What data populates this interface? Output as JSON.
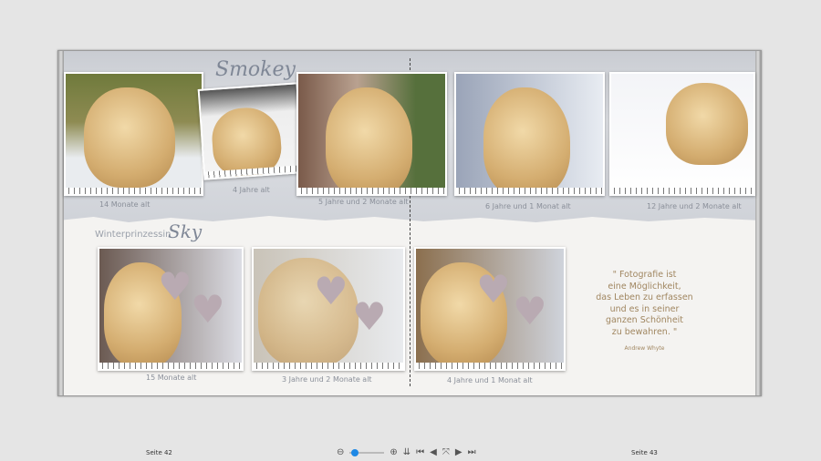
{
  "left_page": {
    "title_top": "Smokey",
    "title_bottom_prefix": "Winterprinzessin",
    "title_bottom_name": "Sky",
    "captions": [
      "14 Monate alt",
      "4 Jahre alt",
      "5 Jahre und 2 Monate alt",
      "15 Monate alt",
      "3 Jahre und 2 Monate alt"
    ],
    "page_label": "Seite 42"
  },
  "right_page": {
    "captions": [
      "6 Jahre und 1 Monat alt",
      "12 Jahre und 2 Monate alt",
      "4 Jahre und 1 Monat alt"
    ],
    "quote": [
      "\" Fotografie ist",
      "eine Möglichkeit,",
      "das Leben zu erfassen",
      "und es in seiner",
      "ganzen Schönheit",
      "zu bewahren. \""
    ],
    "quote_author": "Andrew Whyte",
    "page_label": "Seite 43"
  },
  "toolbar": {
    "zoom_level_percent": 10,
    "accent": "#1e88e5",
    "icons": [
      "zoom-out-icon",
      "zoom-slider",
      "zoom-in-icon",
      "add-page-icon",
      "first-page-icon",
      "previous-page-icon",
      "fit-icon",
      "next-page-icon",
      "last-page-icon"
    ]
  }
}
